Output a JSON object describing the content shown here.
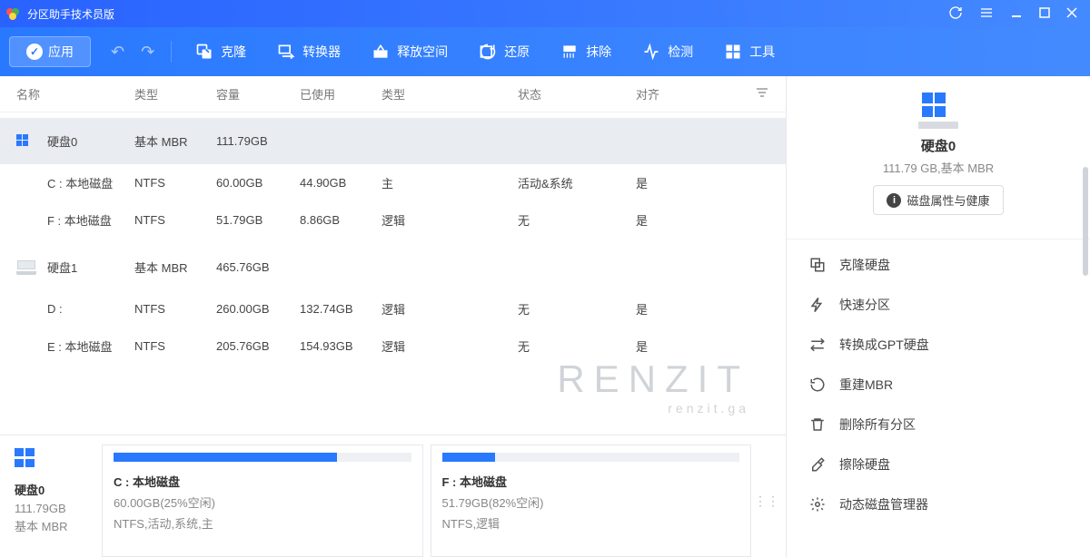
{
  "titlebar": {
    "title": "分区助手技术员版"
  },
  "toolbar": {
    "apply": "应用",
    "items": [
      "克隆",
      "转换器",
      "释放空间",
      "还原",
      "抹除",
      "检测",
      "工具"
    ]
  },
  "columns": [
    "名称",
    "类型",
    "容量",
    "已使用",
    "类型",
    "状态",
    "对齐"
  ],
  "disks": [
    {
      "name": "硬盘0",
      "type": "基本 MBR",
      "capacity": "111.79GB",
      "partitions": [
        {
          "name": "C : 本地磁盘",
          "fs": "NTFS",
          "cap": "60.00GB",
          "used": "44.90GB",
          "ptype": "主",
          "state": "活动&系统",
          "align": "是"
        },
        {
          "name": "F : 本地磁盘",
          "fs": "NTFS",
          "cap": "51.79GB",
          "used": "8.86GB",
          "ptype": "逻辑",
          "state": "无",
          "align": "是"
        }
      ]
    },
    {
      "name": "硬盘1",
      "type": "基本 MBR",
      "capacity": "465.76GB",
      "partitions": [
        {
          "name": "D :",
          "fs": "NTFS",
          "cap": "260.00GB",
          "used": "132.74GB",
          "ptype": "逻辑",
          "state": "无",
          "align": "是"
        },
        {
          "name": "E : 本地磁盘",
          "fs": "NTFS",
          "cap": "205.76GB",
          "used": "154.93GB",
          "ptype": "逻辑",
          "state": "无",
          "align": "是"
        }
      ]
    }
  ],
  "watermark": {
    "big": "RENZIT",
    "small": "renzit.ga"
  },
  "summary": {
    "name": "硬盘0",
    "size": "111.79GB",
    "type": "基本 MBR"
  },
  "cards": [
    {
      "name": "C : 本地磁盘",
      "line1": "60.00GB(25%空闲)",
      "line2": "NTFS,活动,系统,主",
      "pct": 75
    },
    {
      "name": "F : 本地磁盘",
      "line1": "51.79GB(82%空闲)",
      "line2": "NTFS,逻辑",
      "pct": 18
    }
  ],
  "right": {
    "name": "硬盘0",
    "sub": "111.79 GB,基本 MBR",
    "propBtn": "磁盘属性与健康",
    "actions": [
      "克隆硬盘",
      "快速分区",
      "转换成GPT硬盘",
      "重建MBR",
      "删除所有分区",
      "擦除硬盘",
      "动态磁盘管理器"
    ]
  }
}
